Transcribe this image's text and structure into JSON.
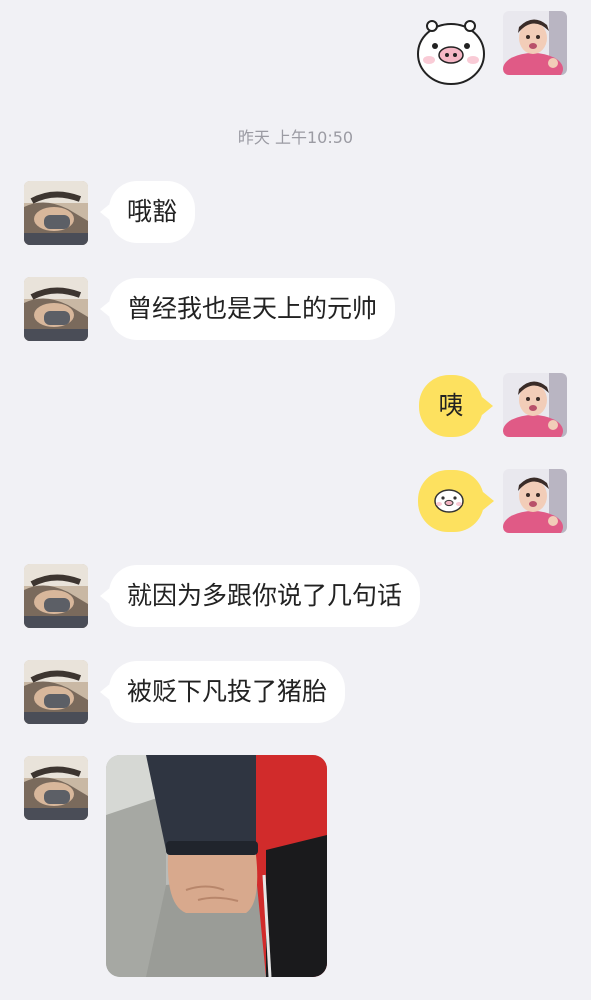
{
  "chat": {
    "timestamp": "昨天 上午10:50",
    "messages": [
      {
        "from": "other",
        "text": "哦豁"
      },
      {
        "from": "other",
        "text": "曾经我也是天上的元帅"
      },
      {
        "from": "me",
        "text": "咦"
      },
      {
        "from": "me",
        "sticker": "pig-face-sticker"
      },
      {
        "from": "other",
        "text": "就因为多跟你说了几句话"
      },
      {
        "from": "other",
        "text": "被贬下凡投了猪胎"
      },
      {
        "from": "other",
        "image": "fist-photo"
      }
    ]
  },
  "colors": {
    "background": "#f1f1f5",
    "incoming_bubble": "#ffffff",
    "outgoing_bubble": "#fde15f",
    "timestamp_text": "#9b9ba3"
  }
}
